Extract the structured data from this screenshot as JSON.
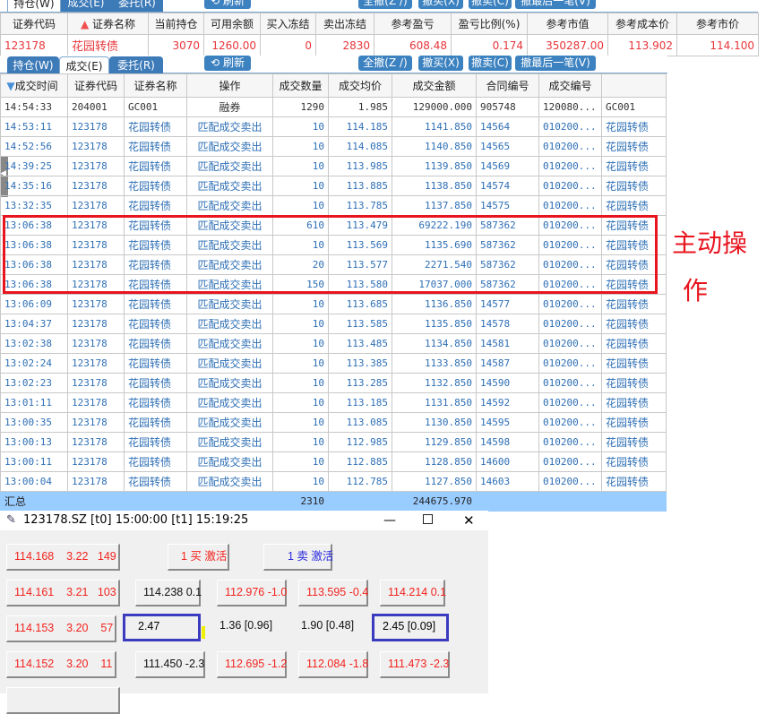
{
  "top_tabs": [
    "持仓(W)",
    "成交(E)",
    "委托(R)"
  ],
  "toolbar": {
    "refresh": "刷新",
    "cancel_all": "全撤(Z /)",
    "cancel_buy": "撤买(X)",
    "cancel_sell": "撤卖(C)",
    "cancel_last": "撤最后一笔(V)"
  },
  "positions": {
    "headers": [
      "证券代码",
      "证券名称",
      "当前持仓",
      "可用余额",
      "买入冻结",
      "卖出冻结",
      "参考盈亏",
      "盈亏比例(%)",
      "参考市值",
      "参考成本价",
      "参考市价"
    ],
    "row": [
      "123178",
      "花园转债",
      "3070",
      "1260.00",
      "0",
      "2830",
      "608.48",
      "0.174",
      "350287.00",
      "113.902",
      "114.100"
    ]
  },
  "tabs": [
    "持仓(W)",
    "成交(E)",
    "委托(R)"
  ],
  "deals": {
    "headers": [
      "成交时间",
      "证券代码",
      "证券名称",
      "操作",
      "成交数量",
      "成交均价",
      "成交金额",
      "合同编号",
      "成交编号",
      ""
    ],
    "rows": [
      [
        "14:54:33",
        "204001",
        "GC001",
        "融券",
        "1290",
        "1.985",
        "129000.000",
        "905748",
        "120080...",
        "GC001"
      ],
      [
        "14:53:11",
        "123178",
        "花园转债",
        "匹配成交卖出",
        "10",
        "114.185",
        "1141.850",
        "14564",
        "010200...",
        "花园转债"
      ],
      [
        "14:52:56",
        "123178",
        "花园转债",
        "匹配成交卖出",
        "10",
        "114.085",
        "1140.850",
        "14565",
        "010200...",
        "花园转债"
      ],
      [
        "14:39:25",
        "123178",
        "花园转债",
        "匹配成交卖出",
        "10",
        "113.985",
        "1139.850",
        "14569",
        "010200...",
        "花园转债"
      ],
      [
        "14:35:16",
        "123178",
        "花园转债",
        "匹配成交卖出",
        "10",
        "113.885",
        "1138.850",
        "14574",
        "010200...",
        "花园转债"
      ],
      [
        "13:32:35",
        "123178",
        "花园转债",
        "匹配成交卖出",
        "10",
        "113.785",
        "1137.850",
        "14575",
        "010200...",
        "花园转债"
      ],
      [
        "13:06:38",
        "123178",
        "花园转债",
        "匹配成交卖出",
        "610",
        "113.479",
        "69222.190",
        "587362",
        "010200...",
        "花园转债"
      ],
      [
        "13:06:38",
        "123178",
        "花园转债",
        "匹配成交卖出",
        "10",
        "113.569",
        "1135.690",
        "587362",
        "010200...",
        "花园转债"
      ],
      [
        "13:06:38",
        "123178",
        "花园转债",
        "匹配成交卖出",
        "20",
        "113.577",
        "2271.540",
        "587362",
        "010200...",
        "花园转债"
      ],
      [
        "13:06:38",
        "123178",
        "花园转债",
        "匹配成交卖出",
        "150",
        "113.580",
        "17037.000",
        "587362",
        "010200...",
        "花园转债"
      ],
      [
        "13:06:09",
        "123178",
        "花园转债",
        "匹配成交卖出",
        "10",
        "113.685",
        "1136.850",
        "14577",
        "010200...",
        "花园转债"
      ],
      [
        "13:04:37",
        "123178",
        "花园转债",
        "匹配成交卖出",
        "10",
        "113.585",
        "1135.850",
        "14578",
        "010200...",
        "花园转债"
      ],
      [
        "13:02:38",
        "123178",
        "花园转债",
        "匹配成交卖出",
        "10",
        "113.485",
        "1134.850",
        "14581",
        "010200...",
        "花园转债"
      ],
      [
        "13:02:24",
        "123178",
        "花园转债",
        "匹配成交卖出",
        "10",
        "113.385",
        "1133.850",
        "14587",
        "010200...",
        "花园转债"
      ],
      [
        "13:02:23",
        "123178",
        "花园转债",
        "匹配成交卖出",
        "10",
        "113.285",
        "1132.850",
        "14590",
        "010200...",
        "花园转债"
      ],
      [
        "13:01:11",
        "123178",
        "花园转债",
        "匹配成交卖出",
        "10",
        "113.185",
        "1131.850",
        "14592",
        "010200...",
        "花园转债"
      ],
      [
        "13:00:35",
        "123178",
        "花园转债",
        "匹配成交卖出",
        "10",
        "113.085",
        "1130.850",
        "14595",
        "010200...",
        "花园转债"
      ],
      [
        "13:00:13",
        "123178",
        "花园转债",
        "匹配成交卖出",
        "10",
        "112.985",
        "1129.850",
        "14598",
        "010200...",
        "花园转债"
      ],
      [
        "13:00:11",
        "123178",
        "花园转债",
        "匹配成交卖出",
        "10",
        "112.885",
        "1128.850",
        "14600",
        "010200...",
        "花园转债"
      ],
      [
        "13:00:04",
        "123178",
        "花园转债",
        "匹配成交卖出",
        "10",
        "112.785",
        "1127.850",
        "14603",
        "010200...",
        "花园转债"
      ]
    ],
    "summary": [
      "汇总",
      "",
      "",
      "",
      "2310",
      "",
      "244675.970",
      "",
      "",
      ""
    ]
  },
  "annotation": {
    "line1": "主动操",
    "line2": "作"
  },
  "window": {
    "title": "123178.SZ [t0] 15:00:00 [t1] 15:19:25",
    "buy_activate": "1 买 激活",
    "sell_activate": "1 卖 激活",
    "levels": [
      "114.168    3.22   149",
      "114.161    3.21   103",
      "114.153    3.20    57",
      "114.152    3.20    11"
    ],
    "row2": [
      "114.238 0.1",
      "112.976 -1.0",
      "113.595 -0.4",
      "114.214 0.1"
    ],
    "row3": [
      "2.47",
      "1.36 [0.96]",
      "1.90 [0.48]",
      "2.45 [0.09]"
    ],
    "row4": [
      "111.450 -2.3",
      "112.695 -1.2",
      "112.084 -1.8",
      "111.473 -2.3"
    ]
  }
}
